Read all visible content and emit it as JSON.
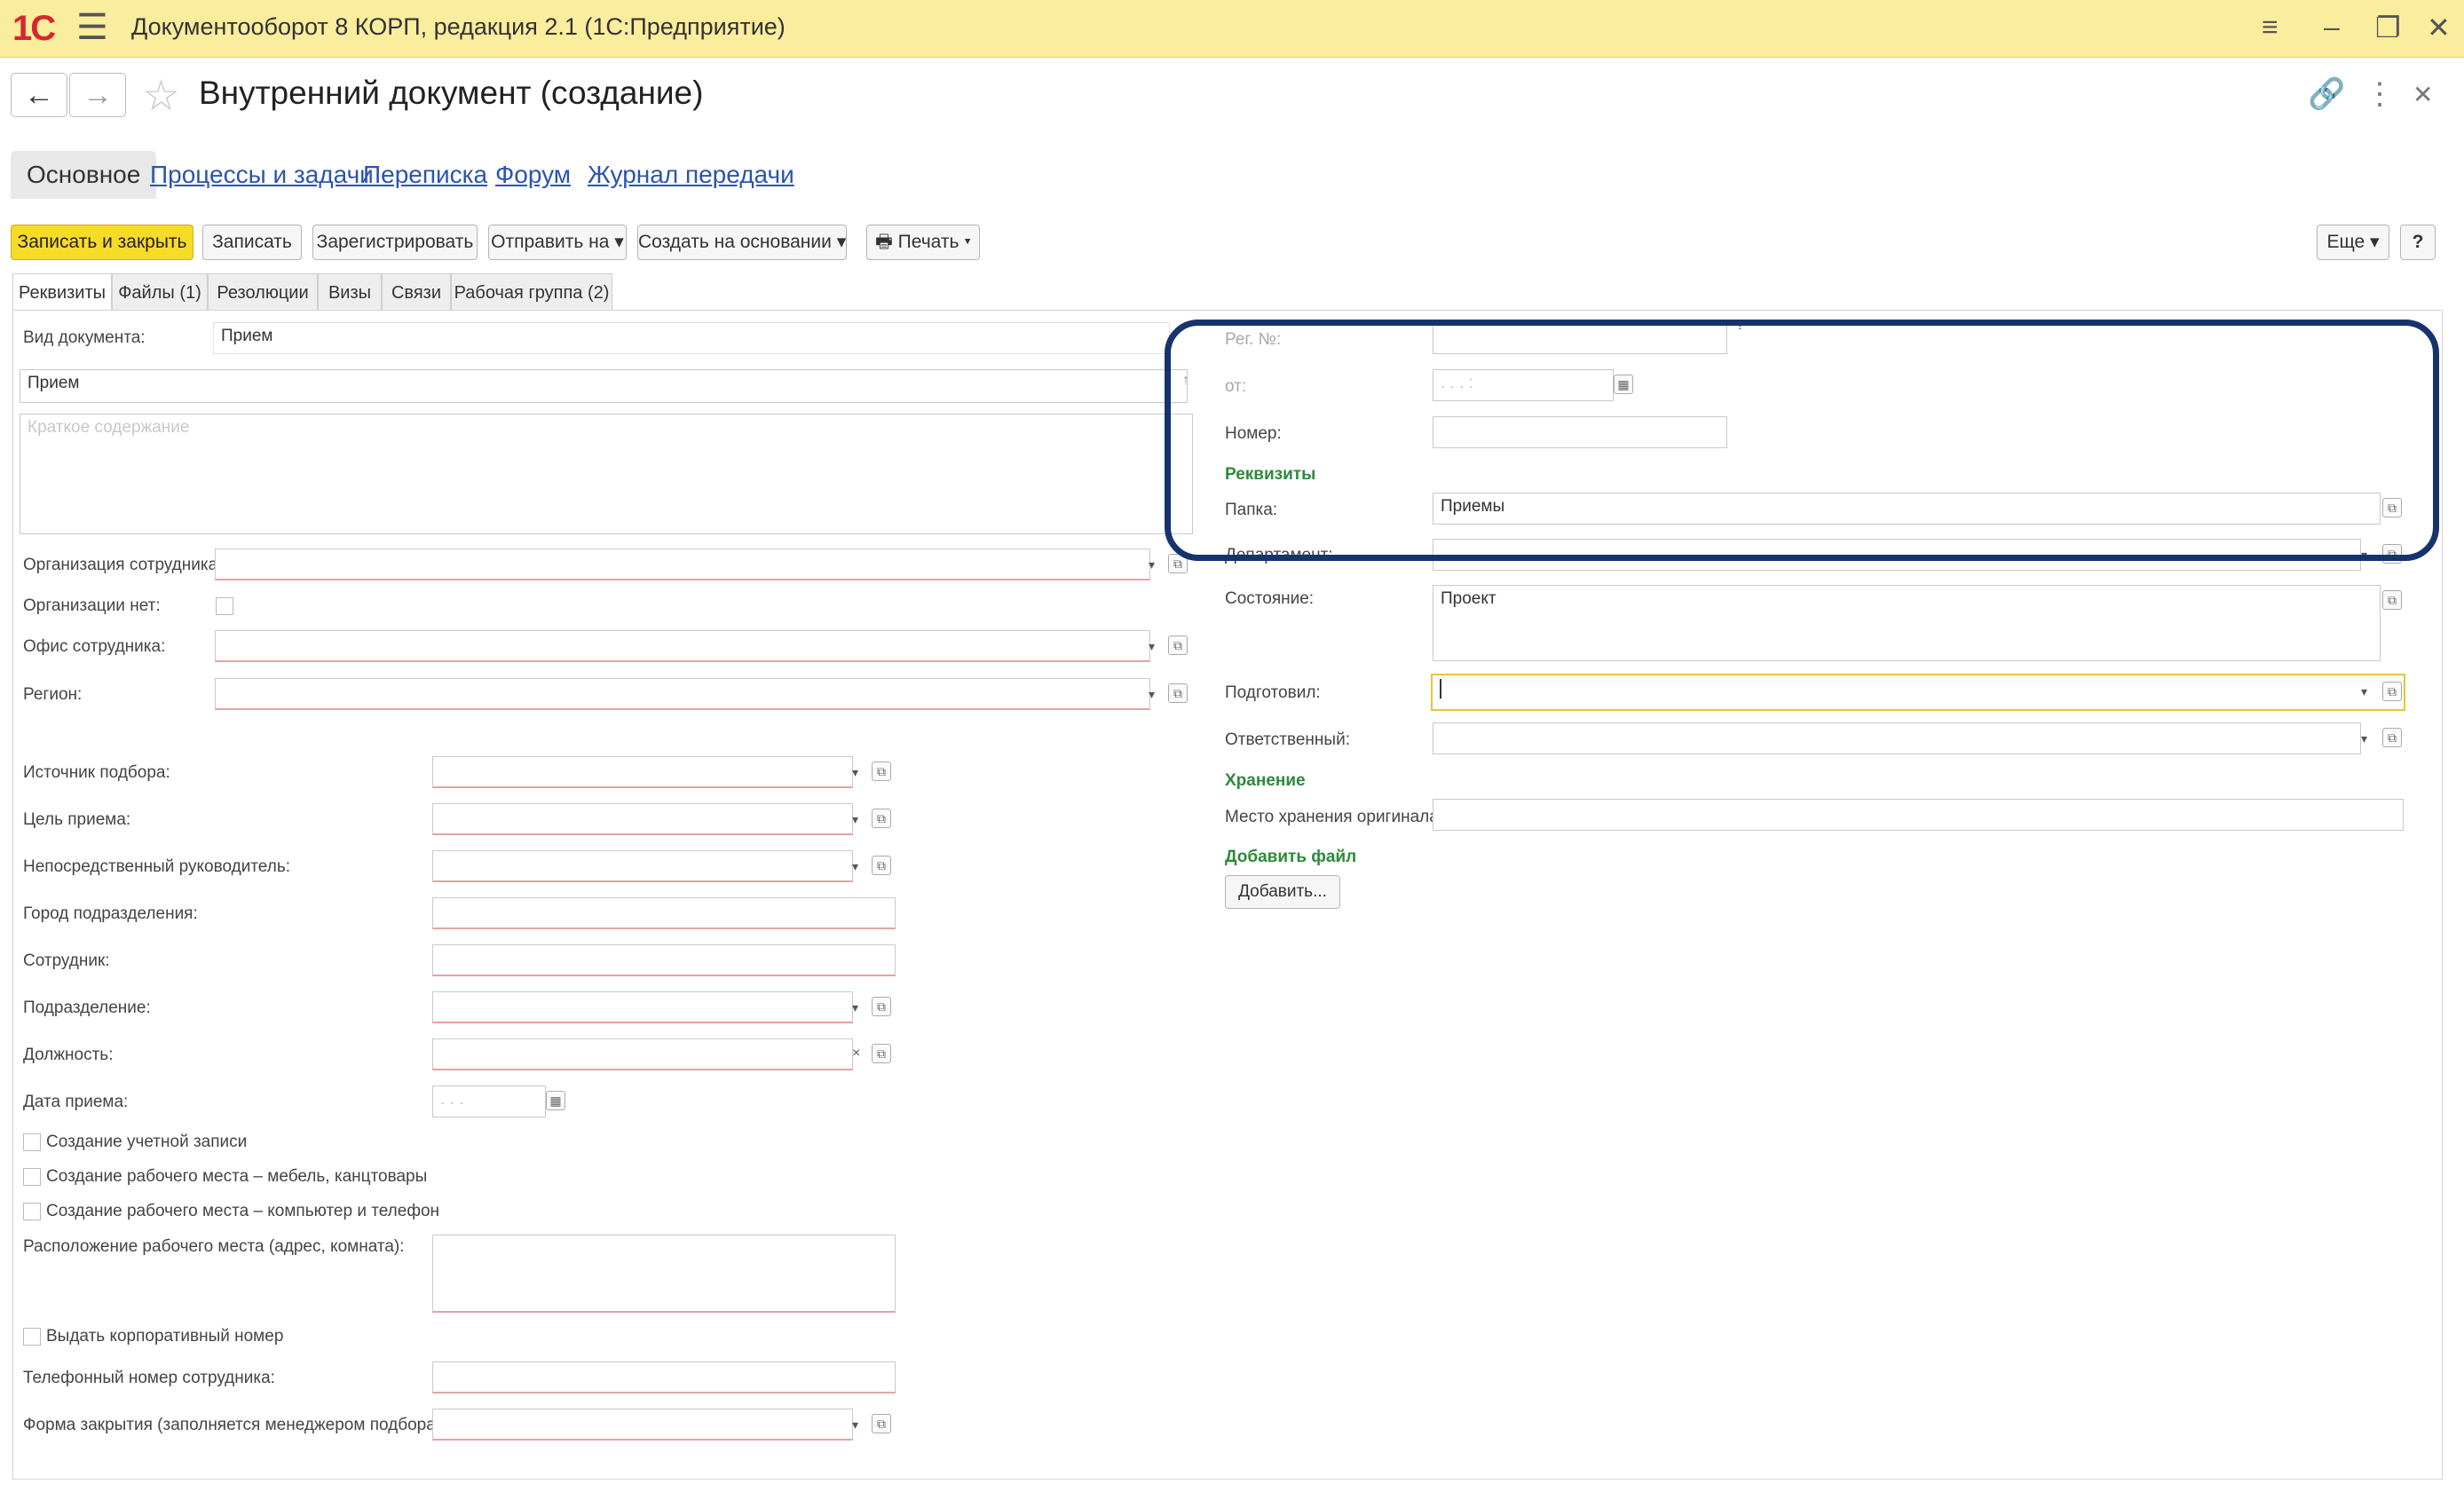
{
  "window": {
    "logo": "1C",
    "title": "Документооборот 8 КОРП, редакция 2.1  (1С:Предприятие)",
    "controls": [
      "menu-icon",
      "minimize-icon",
      "restore-icon",
      "close-icon"
    ]
  },
  "header": {
    "back": "←",
    "forward": "→",
    "title": "Внутренний документ (создание)"
  },
  "main_tabs": [
    "Основное",
    "Процессы и задачи",
    "Переписка",
    "Форум",
    "Журнал передачи"
  ],
  "toolbar": {
    "save_close": "Записать и закрыть",
    "save": "Записать",
    "register": "Зарегистрировать",
    "send": "Отправить на",
    "create_based": "Создать на основании",
    "print": "Печать",
    "more": "Еще",
    "help": "?"
  },
  "tabs": [
    "Реквизиты",
    "Файлы (1)",
    "Резолюции",
    "Визы",
    "Связи",
    "Рабочая группа (2)"
  ],
  "left": {
    "vid_label": "Вид документа:",
    "vid_value": "Прием",
    "name_value": "Прием",
    "summary_placeholder": "Краткое содержание",
    "org_label": "Организация сотрудника:",
    "no_org_label": "Организации нет:",
    "office_label": "Офис сотрудника:",
    "region_label": "Регион:",
    "source_label": "Источник подбора:",
    "goal_label": "Цель приема:",
    "manager_label": "Непосредственный руководитель:",
    "city_label": "Город подразделения:",
    "employee_label": "Сотрудник:",
    "division_label": "Подразделение:",
    "position_label": "Должность:",
    "date_label": "Дата приема:",
    "date_placeholder": ". . .",
    "cb_account": "Создание учетной записи",
    "cb_furniture": "Создание рабочего места – мебель, канцтовары",
    "cb_computer": "Создание рабочего места – компьютер и телефон",
    "location_label": "Расположение рабочего места (адрес, комната):",
    "cb_phone": "Выдать корпоративный номер",
    "phone_label": "Телефонный номер сотрудника:",
    "closing_label": "Форма закрытия (заполняется менеджером подбора):"
  },
  "right": {
    "reg_label": "Рег. №:",
    "from_label": "от:",
    "from_placeholder": ". .  . :",
    "number_label": "Номер:",
    "section_requisites": "Реквизиты",
    "folder_label": "Папка:",
    "folder_value": "Приемы",
    "department_label": "Департамент:",
    "state_label": "Состояние:",
    "state_value": "Проект",
    "prepared_label": "Подготовил:",
    "responsible_label": "Ответственный:",
    "section_storage": "Хранение",
    "storage_label": "Место хранения оригинала:",
    "section_add_file": "Добавить файл",
    "add_button": "Добавить..."
  },
  "colors": {
    "titlebar": "#fbed9e",
    "primary_button": "#f6db27",
    "link": "#2a55b0",
    "section": "#2c8a39",
    "highlight": "#17336e"
  }
}
